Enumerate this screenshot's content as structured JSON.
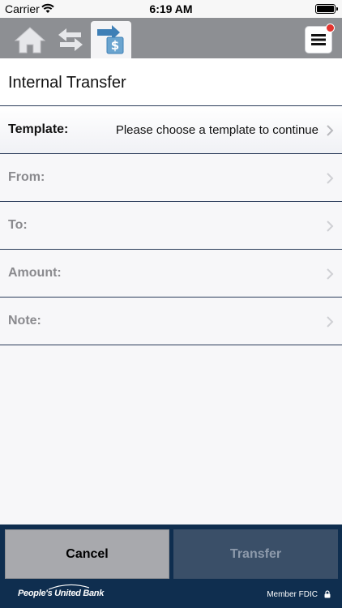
{
  "status_bar": {
    "carrier": "Carrier",
    "time": "6:19 AM"
  },
  "nav": {
    "icons": [
      "home-icon",
      "swap-arrows-icon",
      "transfer-dollar-icon",
      "hamburger-menu-icon"
    ],
    "active_tab": "transfer-dollar-icon",
    "notification_color": "#e3342f"
  },
  "page": {
    "title": "Internal Transfer"
  },
  "form": {
    "template": {
      "label": "Template:",
      "value": "Please choose a template to continue"
    },
    "from": {
      "label": "From:",
      "value": ""
    },
    "to": {
      "label": "To:",
      "value": ""
    },
    "amount": {
      "label": "Amount:",
      "value": ""
    },
    "note": {
      "label": "Note:",
      "value": ""
    }
  },
  "footer": {
    "cancel_label": "Cancel",
    "transfer_label": "Transfer",
    "transfer_enabled": false
  },
  "brand": {
    "logo_text": "People's United Bank",
    "fdic": "Member FDIC"
  },
  "colors": {
    "nav_bg": "#8d8f93",
    "brand_navy": "#0f2e4f",
    "divider": "#2a3c5a"
  }
}
